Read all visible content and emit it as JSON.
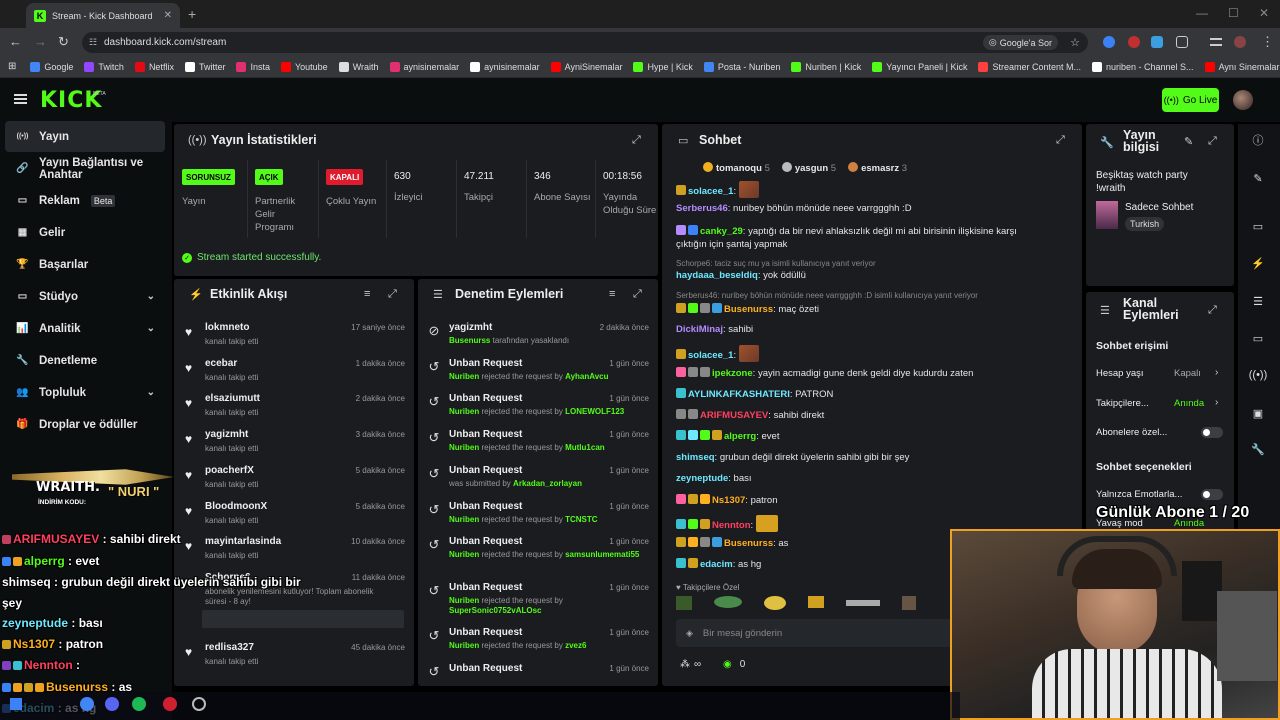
{
  "browser": {
    "tab_title": "Stream - Kick Dashboard",
    "url": "dashboard.kick.com/stream",
    "google_sor": "Google'a Sor",
    "bookmarks": [
      {
        "label": "Google",
        "color": "#4285f4"
      },
      {
        "label": "Twitch",
        "color": "#9146ff"
      },
      {
        "label": "Netflix",
        "color": "#e50914"
      },
      {
        "label": "Twitter",
        "color": "#ffffff"
      },
      {
        "label": "Insta",
        "color": "#e1306c"
      },
      {
        "label": "Youtube",
        "color": "#ff0000"
      },
      {
        "label": "Wraith",
        "color": "#dddddd"
      },
      {
        "label": "aynisinemalar",
        "color": "#e1306c"
      },
      {
        "label": "aynisinemalar",
        "color": "#ffffff"
      },
      {
        "label": "AyniSinemalar",
        "color": "#ff0000"
      },
      {
        "label": "Hype | Kick",
        "color": "#53fc18"
      },
      {
        "label": "Posta - Nuriben",
        "color": "#4285f4"
      },
      {
        "label": "Nuriben | Kick",
        "color": "#53fc18"
      },
      {
        "label": "Yayıncı Paneli | Kick",
        "color": "#53fc18"
      },
      {
        "label": "Streamer Content M...",
        "color": "#ff4040"
      },
      {
        "label": "nuriben - Channel S...",
        "color": "#ffffff"
      },
      {
        "label": "Aynı Sinemalar - Ça...",
        "color": "#ff0000"
      }
    ]
  },
  "header": {
    "brand": "KICK",
    "beta": "BETA",
    "go_live": "Go Live"
  },
  "sidebar": {
    "items": [
      {
        "label": "Yayın",
        "icon": "broadcast-icon"
      },
      {
        "label": "Yayın Bağlantısı ve Anahtar",
        "icon": "link-icon"
      },
      {
        "label": "Reklam",
        "icon": "ad-icon",
        "badge": "Beta"
      },
      {
        "label": "Gelir",
        "icon": "grid-icon"
      },
      {
        "label": "Başarılar",
        "icon": "trophy-icon"
      },
      {
        "label": "Stüdyo",
        "icon": "studio-icon"
      },
      {
        "label": "Analitik",
        "icon": "chart-icon"
      },
      {
        "label": "Denetleme",
        "icon": "wrench-icon"
      },
      {
        "label": "Topluluk",
        "icon": "community-icon"
      },
      {
        "label": "Droplar ve ödüller",
        "icon": "gift-icon"
      }
    ]
  },
  "stats": {
    "title": "Yayın İstatistikleri",
    "cards": [
      {
        "badge": "SORUNSUZ",
        "label": "Yayın"
      },
      {
        "badge": "AÇIK",
        "label": "Partnerlik Gelir Programı"
      },
      {
        "badge": "KAPALI",
        "label": "Çoklu Yayın"
      },
      {
        "value": "630",
        "label": "İzleyici"
      },
      {
        "value": "47.211",
        "label": "Takipçi"
      },
      {
        "value": "346",
        "label": "Abone Sayısı"
      },
      {
        "value": "00:18:56",
        "label": "Yayında Olduğu Süre"
      }
    ],
    "success": "Stream started successfully."
  },
  "activity": {
    "title": "Etkinlik Akışı",
    "items": [
      {
        "name": "lokmneto",
        "sub": "kanalı takip etti",
        "time": "17 saniye önce"
      },
      {
        "name": "ecebar",
        "sub": "kanalı takip etti",
        "time": "1 dakika önce"
      },
      {
        "name": "elsaziumutt",
        "sub": "kanalı takip etti",
        "time": "2 dakika önce"
      },
      {
        "name": "yagizmht",
        "sub": "kanalı takip etti",
        "time": "3 dakika önce"
      },
      {
        "name": "poacherfX",
        "sub": "kanalı takip etti",
        "time": "5 dakika önce"
      },
      {
        "name": "BloodmoonX",
        "sub": "kanalı takip etti",
        "time": "5 dakika önce"
      },
      {
        "name": "mayintarlasinda",
        "sub": "kanalı takip etti",
        "time": "10 dakika önce"
      },
      {
        "name": "Schorpe6",
        "sub": "abonelik yenilemesini kutluyor! Toplam abonelik süresi - 8 ay!",
        "time": "11 dakika önce"
      },
      {
        "name": "redlisa327",
        "sub": "kanalı takip etti",
        "time": "45 dakika önce"
      }
    ]
  },
  "moderation": {
    "title": "Denetim Eylemleri",
    "items": [
      {
        "name": "yagizmht",
        "actor": "Busenurss",
        "text": "tarafından yasaklandı",
        "target": "",
        "time": "2 dakika önce"
      },
      {
        "name": "Unban Request",
        "actor": "Nuriben",
        "text": "rejected the request by",
        "target": "AyhanAvcu",
        "time": "1 gün önce"
      },
      {
        "name": "Unban Request",
        "actor": "Nuriben",
        "text": "rejected the request by",
        "target": "LONEWOLF123",
        "time": "1 gün önce"
      },
      {
        "name": "Unban Request",
        "actor": "Nuriben",
        "text": "rejected the request by",
        "target": "Mutlu1can",
        "time": "1 gün önce"
      },
      {
        "name": "Unban Request",
        "actor": "",
        "text": "was submitted by",
        "target": "Arkadan_zorlayan",
        "time": "1 gün önce"
      },
      {
        "name": "Unban Request",
        "actor": "Nuriben",
        "text": "rejected the request by",
        "target": "TCNSTC",
        "time": "1 gün önce"
      },
      {
        "name": "Unban Request",
        "actor": "Nuriben",
        "text": "rejected the request by",
        "target": "samsunlumemati55",
        "time": "1 gün önce"
      },
      {
        "name": "Unban Request",
        "actor": "Nuriben",
        "text": "rejected the request by",
        "target": "SuperSonic0752vALOsc",
        "time": "1 gün önce"
      },
      {
        "name": "Unban Request",
        "actor": "Nuriben",
        "text": "rejected the request by",
        "target": "zvez6",
        "time": "1 gün önce"
      },
      {
        "name": "Unban Request",
        "actor": "",
        "text": "",
        "target": "",
        "time": "1 gün önce"
      }
    ]
  },
  "chat": {
    "title": "Sohbet",
    "top_gifters": [
      {
        "name": "tomanoqu",
        "count": "5"
      },
      {
        "name": "yasgun",
        "count": "5"
      },
      {
        "name": "esmasrz",
        "count": "3"
      }
    ],
    "followers_only": "Takipçilere Özel",
    "input_placeholder": "Bir mesaj gönderin",
    "footer_count": "0",
    "footer_inf": "∞",
    "reply1": "Schorpe6: taciz suç mu ya isimli kullanıcıya yanıt veriyor",
    "reply2": "Serberus46: nuribey böhün mönüde neee varrggghh :D isimli kullanıcıya yanıt veriyor",
    "messages": [
      {
        "user": "solacee_1",
        "color": "#6ee8ff",
        "text": ""
      },
      {
        "user": "Serberus46",
        "color": "#b48cff",
        "text": "nuribey böhün mönüde neee varrggghh :D"
      },
      {
        "user": "canky_29",
        "color": "#53fc18",
        "text": "yaptığı da bir nevi ahlaksızlık değil mi abi birisinin ilişkisine karşı"
      },
      {
        "user": "",
        "color": "",
        "text": "çıktığın için şantaj yapmak"
      },
      {
        "user": "haydaaa_beseldiq",
        "color": "#6ee8ff",
        "text": "yok ödüllü"
      },
      {
        "user": "Busenurss",
        "color": "#ffb020",
        "text": "maç özeti"
      },
      {
        "user": "DickiMinaj",
        "color": "#b48cff",
        "text": "sahibi"
      },
      {
        "user": "solacee_1",
        "color": "#6ee8ff",
        "text": ""
      },
      {
        "user": "ipekzone",
        "color": "#53fc18",
        "text": "yayin acmadigi gune denk geldi diye kudurdu zaten"
      },
      {
        "user": "AYLINKAFKASHATERI",
        "color": "#6ee8ff",
        "text": "PATRON"
      },
      {
        "user": "ARIFMUSAYEV",
        "color": "#ff4060",
        "text": "sahibi direkt"
      },
      {
        "user": "alperrg",
        "color": "#53fc18",
        "text": "evet"
      },
      {
        "user": "shimseq",
        "color": "#6ee8ff",
        "text": "grubun değil direkt üyelerin sahibi gibi bir şey"
      },
      {
        "user": "zeyneptude",
        "color": "#6ee8ff",
        "text": "bası"
      },
      {
        "user": "Ns1307",
        "color": "#ffb020",
        "text": "patron"
      },
      {
        "user": "Nennton",
        "color": "#ff4060",
        "text": ""
      },
      {
        "user": "Busenurss",
        "color": "#ffb020",
        "text": "as"
      },
      {
        "user": "edacim",
        "color": "#6ee8ff",
        "text": "as hg"
      }
    ]
  },
  "stream_info": {
    "title": "Yayın bilgisi",
    "stream_title": "Beşiktaş watch party !wraith",
    "category": "Sadece Sohbet",
    "tag": "Turkish"
  },
  "channel_actions": {
    "title": "Kanal Eylemleri",
    "chat_access": "Sohbet erişimi",
    "rows": [
      {
        "label": "Hesap yaşı",
        "value": "Kapalı"
      },
      {
        "label": "Takipçilere...",
        "value": "Anında"
      },
      {
        "label": "Abonelere özel...",
        "value": ""
      }
    ],
    "chat_options": "Sohbet seçenekleri",
    "emote_only": "Yalnızca Emotlarla...",
    "slow_mode": "Yavaş mod",
    "slow_value": "Anında"
  },
  "overlay": {
    "sub_goal": "Günlük Abone 1 / 20",
    "wraith_brand": "WRAITH.",
    "wraith_code_label": "İNDİRİM KODU:",
    "wraith_code": "\" NURI \"",
    "chat": [
      {
        "user": "ARIFMUSAYEV",
        "color": "#ff4060",
        "text": ": sahibi direkt"
      },
      {
        "user": "alperrg",
        "color": "#53fc18",
        "text": ": evet"
      },
      {
        "user": "shimseq",
        "color": "#ffffff",
        "text": ": grubun değil direkt üyelerin sahibi gibi bir"
      },
      {
        "user": "",
        "color": "",
        "text": "şey"
      },
      {
        "user": "zeyneptude",
        "color": "#6ee8ff",
        "text": ": bası"
      },
      {
        "user": "Ns1307",
        "color": "#ffb020",
        "text": ": patron"
      },
      {
        "user": "Nennton",
        "color": "#ff4060",
        "text": ":"
      },
      {
        "user": "Busenurss",
        "color": "#ffb020",
        "text": ": as"
      },
      {
        "user": "edacim",
        "color": "#6ee8ff",
        "text": ": as hg"
      }
    ]
  }
}
